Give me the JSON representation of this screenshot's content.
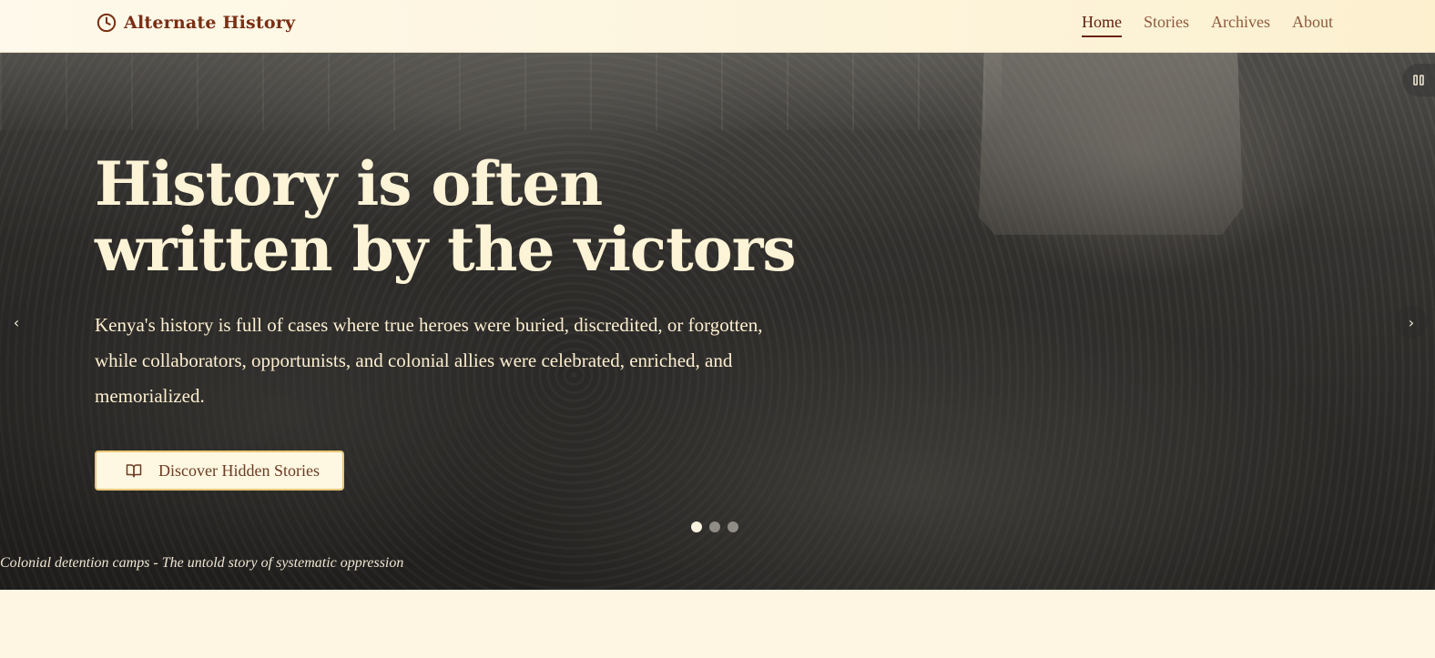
{
  "header": {
    "brand": "Alternate History",
    "nav": [
      {
        "label": "Home",
        "active": true
      },
      {
        "label": "Stories",
        "active": false
      },
      {
        "label": "Archives",
        "active": false
      },
      {
        "label": "About",
        "active": false
      }
    ]
  },
  "hero": {
    "heading": "History is often written by the victors",
    "lead": "Kenya's history is full of cases where true heroes were buried, discredited, or forgotten, while collaborators, opportunists, and colonial allies were celebrated, enriched, and memorialized.",
    "cta_label": "Discover Hidden Stories",
    "caption": "Colonial detention camps - The untold story of systematic oppression",
    "slide_count": 3,
    "active_slide": 1,
    "prev_arrow": "‹",
    "next_arrow": "›"
  },
  "icons": {
    "brand": "clock-icon",
    "cta": "book-open-icon",
    "pause": "pause-icon"
  },
  "colors": {
    "brand": "#7a2f14",
    "nav_active": "#5f1e0d",
    "cta_border": "#e8c775",
    "hero_text": "#fdf3d6"
  }
}
